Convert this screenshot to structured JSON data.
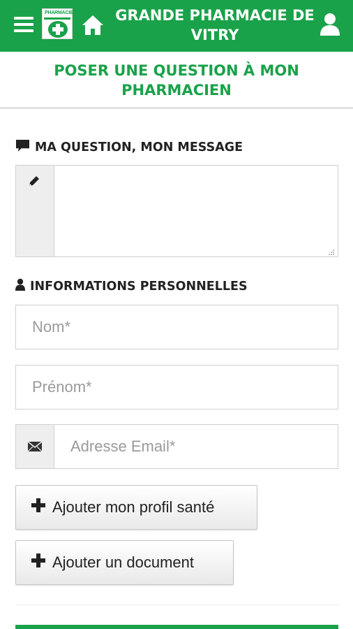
{
  "header": {
    "title": "GRANDE PHARMACIE DE VITRY",
    "logo_text": "PHARMACIE",
    "menu_icon": "hamburger-icon",
    "home_icon": "home-icon",
    "user_icon": "user-icon"
  },
  "page": {
    "subtitle": "POSER UNE QUESTION À MON PHARMACIEN"
  },
  "question": {
    "label": "MA QUESTION, MON MESSAGE",
    "icon": "comment-icon",
    "addon_icon": "pencil-icon",
    "value": ""
  },
  "personal": {
    "label": "INFORMATIONS PERSONNELLES",
    "icon": "user-icon",
    "nom_placeholder": "Nom*",
    "prenom_placeholder": "Prénom*",
    "email_placeholder": "Adresse Email*",
    "email_icon": "envelope-icon"
  },
  "actions": {
    "add_profile_label": "Ajouter mon profil santé",
    "add_document_label": "Ajouter un document",
    "plus_icon": "plus-icon"
  },
  "colors": {
    "brand_green": "#1aa24a",
    "addon_bg": "#eeeeee"
  }
}
